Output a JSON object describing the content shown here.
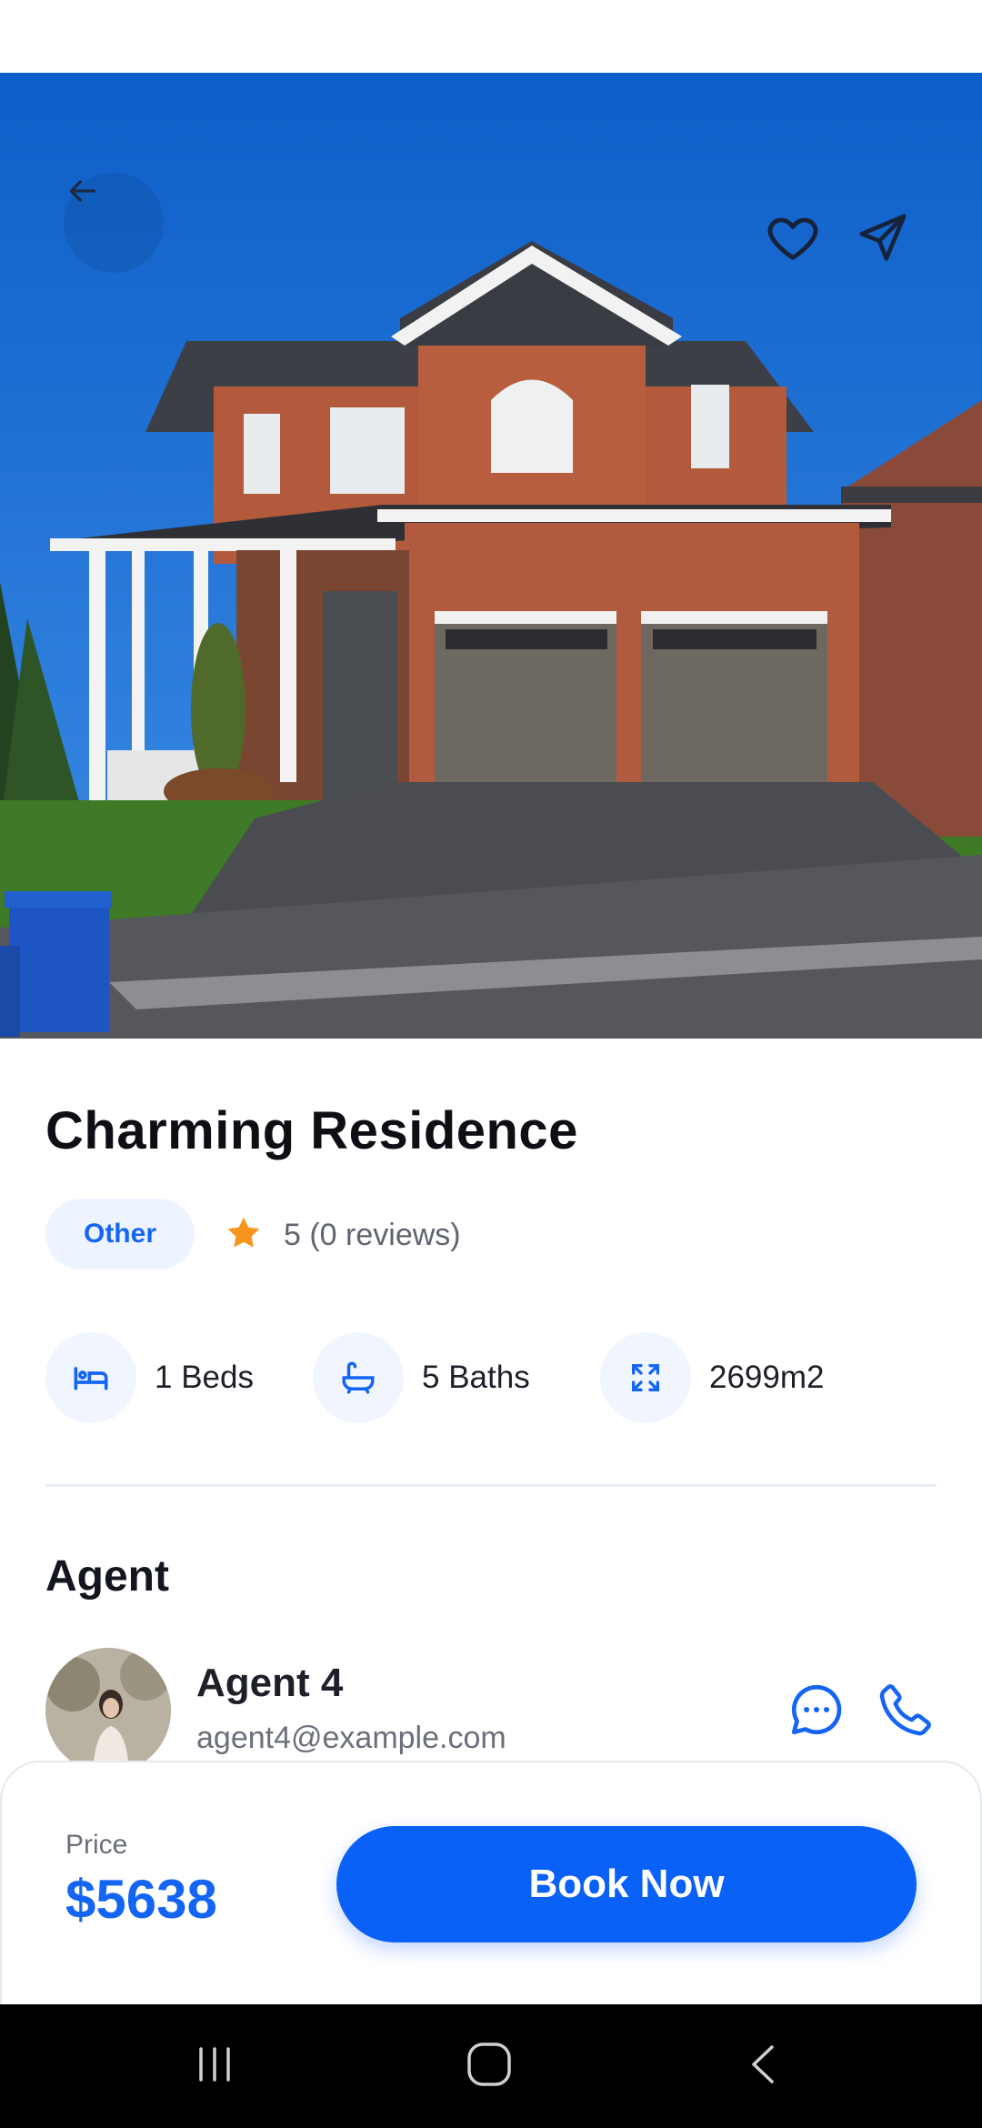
{
  "property": {
    "title": "Charming Residence",
    "category": "Other",
    "rating_text": "5 (0 reviews)",
    "rating_value": 5
  },
  "features": [
    {
      "icon": "bed-icon",
      "label": "1 Beds"
    },
    {
      "icon": "bath-icon",
      "label": "5 Baths"
    },
    {
      "icon": "area-expand-icon",
      "label": "2699m2"
    }
  ],
  "agent_section": {
    "title": "Agent",
    "name": "Agent 4",
    "email": "agent4@example.com"
  },
  "footer": {
    "price_label": "Price",
    "price_value": "$5638",
    "book_label": "Book Now"
  },
  "colors": {
    "accent": "#0a61f7",
    "star": "#f7941d",
    "badge_bg": "#eef4ff"
  },
  "icons": {
    "back": "arrow-left-icon",
    "favorite": "heart-icon",
    "share": "send-icon",
    "chat": "chat-bubble-icon",
    "phone": "phone-icon",
    "star": "star-icon"
  }
}
